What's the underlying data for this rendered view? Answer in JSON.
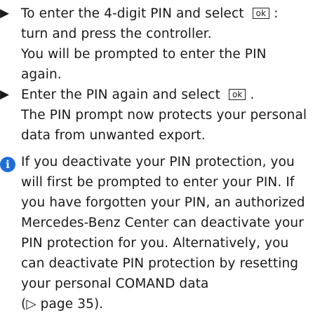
{
  "steps": [
    {
      "lines": [
        "To enter the 4-digit PIN and select",
        "turn and press the controller.",
        "You will be prompted to enter the PIN",
        "again."
      ],
      "key_label": "ok",
      "trailing": ":"
    },
    {
      "lines": [
        "Enter the PIN again and select",
        "The PIN prompt now protects your personal",
        "data from unwanted export."
      ],
      "key_label": "ok",
      "trailing": "."
    }
  ],
  "note": {
    "icon": "info-icon",
    "lines": [
      "If you deactivate your PIN protection, you",
      "will first be prompted to enter your PIN. If",
      "you have forgotten your PIN, an authorized",
      "Mercedes-Benz Center can deactivate your",
      "PIN protection for you. Alternatively, you",
      "can deactivate PIN protection by resetting",
      "your personal COMAND data",
      "(▷ page 35)."
    ]
  }
}
